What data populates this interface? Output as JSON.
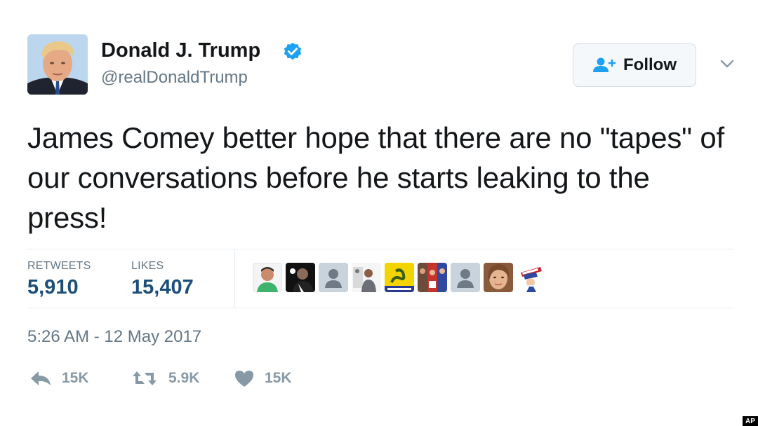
{
  "author": {
    "name": "Donald J. Trump",
    "handle": "@realDonaldTrump",
    "verified": true,
    "avatar_icon": "portrait-avatar"
  },
  "follow_button": {
    "label": "Follow",
    "icon": "add-user-icon"
  },
  "menu_icon": "chevron-down-icon",
  "tweet": {
    "text": "James Comey better hope that there are no \"tapes\" of our conversations before he starts leaking to the press!"
  },
  "stats": {
    "retweets_label": "RETWEETS",
    "retweets_value": "5,910",
    "likes_label": "LIKES",
    "likes_value": "15,407"
  },
  "likers": [
    {
      "icon": "liker-avatar-green"
    },
    {
      "icon": "liker-avatar-dark"
    },
    {
      "icon": "default-avatar"
    },
    {
      "icon": "liker-avatar-photo"
    },
    {
      "icon": "gadsden-flag-avatar"
    },
    {
      "icon": "liker-avatar-collage"
    },
    {
      "icon": "default-avatar"
    },
    {
      "icon": "liker-avatar-face"
    },
    {
      "icon": "uncle-sam-avatar"
    }
  ],
  "timestamp": "5:26 AM - 12 May 2017",
  "actions": {
    "reply_count": "15K",
    "retweet_count": "5.9K",
    "like_count": "15K"
  },
  "watermark": "AP",
  "colors": {
    "verified_blue": "#1da1f2",
    "stat_value": "#1b4f7a",
    "muted": "#657786",
    "action_gray": "#8899a6"
  }
}
